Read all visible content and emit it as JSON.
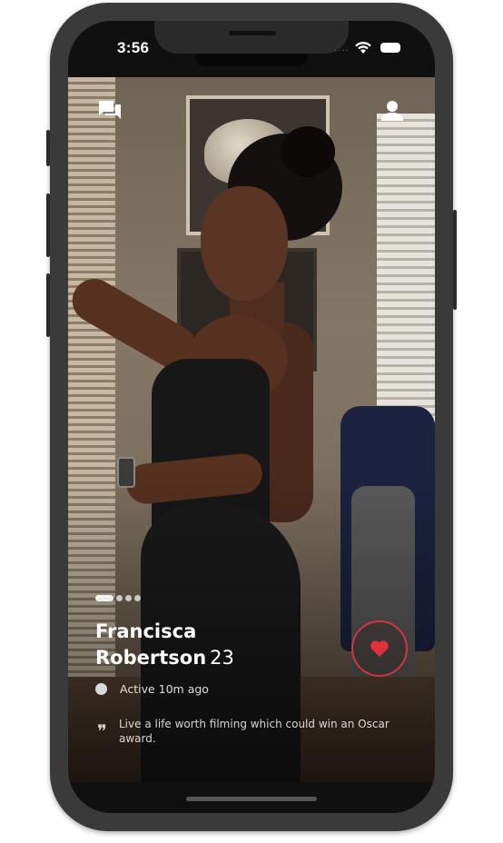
{
  "status_bar": {
    "time": "3:56",
    "signal": "····"
  },
  "header": {
    "left_icon": "chat-bubbles-icon",
    "right_icon": "person-icon"
  },
  "profile": {
    "name_first": "Francisca",
    "name_last": "Robertson",
    "age": "23",
    "active_status": "Active 10m ago",
    "bio": "Live a life worth filming which could win an Oscar award.",
    "photo_count": 4,
    "photo_index": 1
  },
  "actions": {
    "like_icon": "heart-icon"
  },
  "colors": {
    "accent": "#e0313c",
    "screen_bg": "#101010",
    "device_frame": "#3a3a3a"
  }
}
